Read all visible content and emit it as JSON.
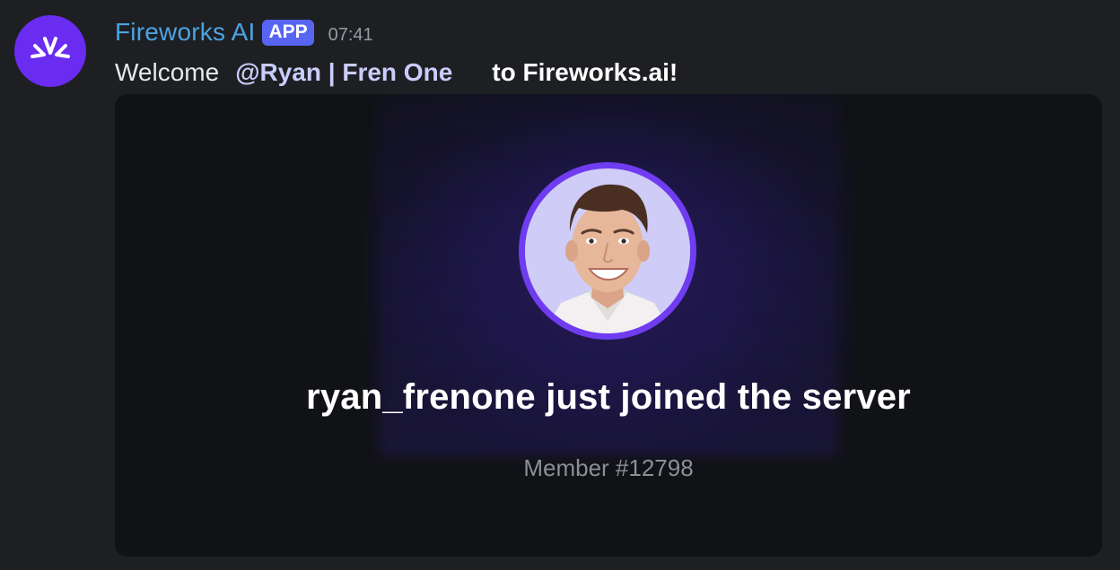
{
  "message": {
    "author": "Fireworks AI",
    "badge": "APP",
    "timestamp": "07:41",
    "text_prefix": "Welcome",
    "mention": "@Ryan | Fren One",
    "text_suffix": "to Fireworks.ai!"
  },
  "embed": {
    "headline": "ryan_frenone just joined the server",
    "member_number": "Member #12798"
  },
  "icons": {
    "avatar": "fireworks-logo-icon",
    "profile": "user-profile-photo"
  },
  "colors": {
    "author_name": "#4aa4e3",
    "badge_bg": "#5865f2",
    "avatar_bg": "#6a2cf0",
    "ring": "#6f3cf0",
    "background": "#1e1f22",
    "card_bg": "#111216"
  }
}
